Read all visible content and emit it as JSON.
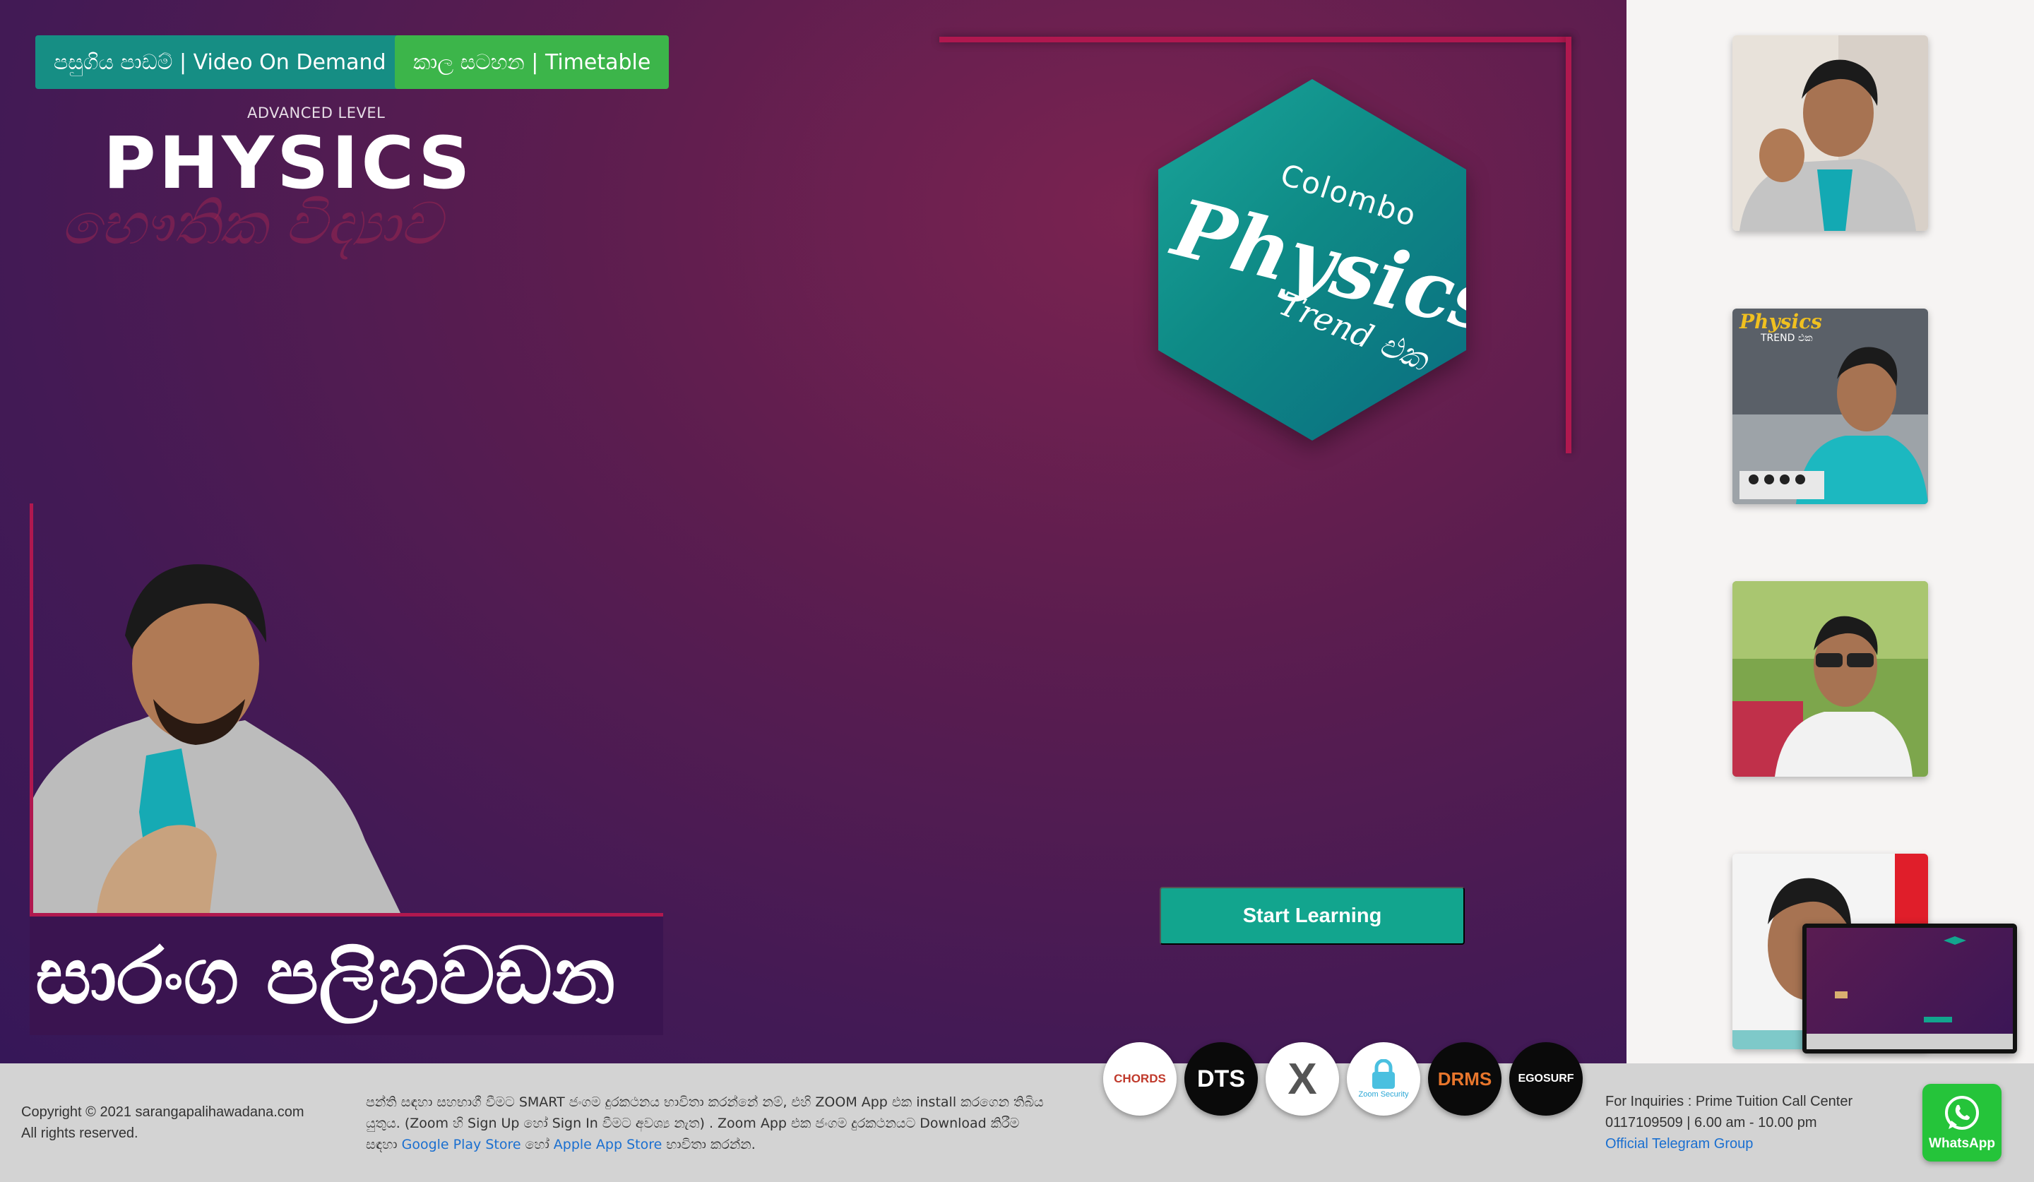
{
  "header_buttons": {
    "vod_label": "පසුගිය පාඩම් | Video On Demand",
    "timetable_label": "කාල සටහන | Timetable"
  },
  "logo": {
    "advanced_level": "ADVANCED LEVEL",
    "physics": "PHYSICS",
    "physics_sinhala": "භෞතික විද්‍යාව"
  },
  "hex_logo": {
    "colombo": "Colombo",
    "physics": "Physics",
    "trend": "Trend එක"
  },
  "teacher": {
    "name": "සාරංග පලිහවඩන"
  },
  "start_label": "Start Learning",
  "footer": {
    "copyright": "Copyright © 2021 sarangapalihawadana.com",
    "rights": "All rights reserved.",
    "zoom_text_1": "පන්ති සඳහා සහභාගී වීමට SMART ජංගම දුරකථනය භාවිතා කරන්නේ නම්, එහි ZOOM App එක install කරගෙන තිබිය යුතුය. (Zoom හි Sign Up හෝ Sign In වීමට අවශ්‍ය නැත) . Zoom App එක ජංගම දුරකථනයට Download කිරීම සඳහා",
    "google_play": "Google Play Store",
    "or": "හෝ",
    "apple_store": "Apple App Store",
    "zoom_text_2": "භාවිතා කරන්න.",
    "inquiries": "For Inquiries : Prime Tuition Call Center",
    "phone": "0117109509 | 6.00 am - 10.00 pm",
    "telegram": "Official Telegram Group"
  },
  "partners": [
    {
      "name": "CHORDS",
      "bg": "#ffffff",
      "color": "#c0392b"
    },
    {
      "name": "DTS",
      "bg": "#0a0a0a",
      "color": "#ffffff"
    },
    {
      "name": "X",
      "bg": "#ffffff",
      "color": "#555555"
    },
    {
      "name": "Zoom Security",
      "bg": "#ffffff",
      "color": "#2aa7d6"
    },
    {
      "name": "DRMS",
      "bg": "#0a0a0a",
      "color": "#e8762c"
    },
    {
      "name": "EGOSURF",
      "bg": "#0a0a0a",
      "color": "#ffffff"
    }
  ],
  "whatsapp_label": "WhatsApp"
}
